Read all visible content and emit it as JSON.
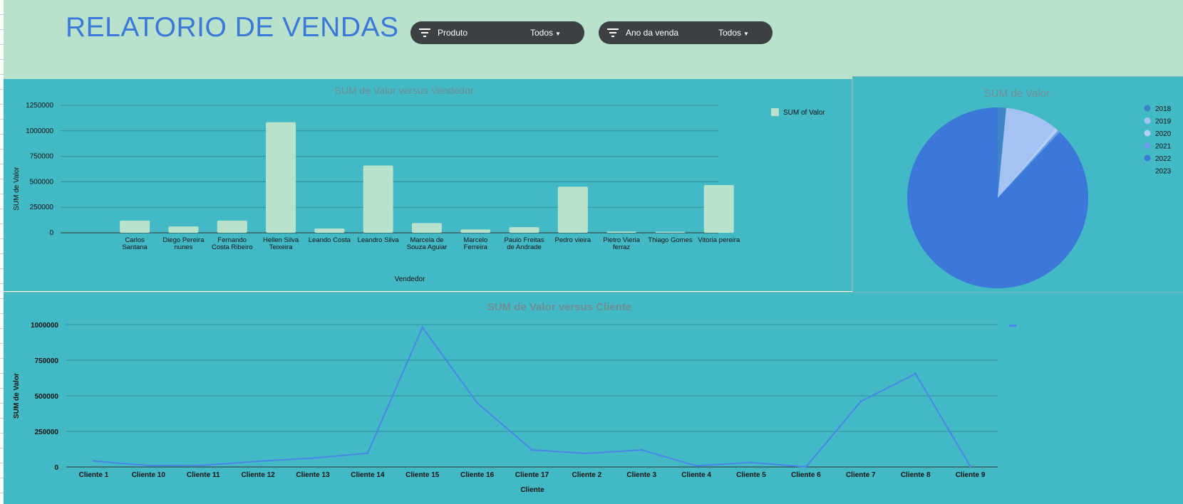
{
  "header": {
    "title": "RELATORIO DE VENDAS",
    "filters": [
      {
        "label": "Produto",
        "value": "Todos"
      },
      {
        "label": "Ano da venda",
        "value": "Todos"
      }
    ]
  },
  "colors": {
    "header_bg": "#b8e2cc",
    "panel_bg": "#44b9c6",
    "bar": "#b8e2cc",
    "line": "#4a86e8",
    "title": "#3c78d8"
  },
  "chart_data": [
    {
      "type": "bar",
      "title": "SUM de Valor versus Vendedor",
      "xlabel": "Vendedor",
      "ylabel": "SUM de Valor",
      "legend": [
        "SUM of Valor"
      ],
      "legend_position": "top-right",
      "ylim": [
        0,
        1250000
      ],
      "yticks": [
        "1250000",
        "1000000",
        "750000",
        "500000",
        "250000",
        "0"
      ],
      "categories": [
        "Carlos Santana",
        "Diego Pereira nunes",
        "Fernando Costa Ribeiro",
        "Hellen Silva Teixeira",
        "Leando Costa",
        "Leandro Silva",
        "Marcela de Souza Aguiar",
        "Marcelo Ferreira",
        "Paulo Freitas de Andrade",
        "Pedro vieira",
        "Pietro Vieria ferraz",
        "Thiago Gomes",
        "Vitoria pereira"
      ],
      "category_lines": [
        [
          "Carlos",
          "Santana"
        ],
        [
          "Diego Pereira",
          "nunes"
        ],
        [
          "Fernando",
          "Costa Ribeiro"
        ],
        [
          "Hellen Silva",
          "Teixeira"
        ],
        [
          "Leando Costa"
        ],
        [
          "Leandro Silva"
        ],
        [
          "Marcela de",
          "Souza Aguiar"
        ],
        [
          "Marcelo",
          "Ferreira"
        ],
        [
          "Paulo Freitas",
          "de Andrade"
        ],
        [
          "Pedro vieira"
        ],
        [
          "Pietro Vieria",
          "ferraz"
        ],
        [
          "Thiago Gomes"
        ],
        [
          "Vitoria pereira"
        ]
      ],
      "values": [
        120000,
        62000,
        120000,
        1085000,
        42000,
        660000,
        95000,
        32000,
        55000,
        452000,
        12000,
        10000,
        468000
      ]
    },
    {
      "type": "pie",
      "title": "SUM de Valor",
      "legend_position": "right",
      "labels": [
        "2018",
        "2019",
        "2020",
        "2021",
        "2022",
        "2023"
      ],
      "values": [
        1.5,
        9.5,
        0.6,
        0.4,
        88.0,
        0
      ],
      "colors": [
        "#3d85c6",
        "#a4c2f4",
        "#b6cff3",
        "#6d9eeb",
        "#3c78d8",
        "#44b9c6"
      ]
    },
    {
      "type": "line",
      "title": "SUM de Valor versus Cliente",
      "xlabel": "Cliente",
      "ylabel": "SUM de Valor",
      "ylim": [
        0,
        1000000
      ],
      "yticks": [
        "1000000",
        "750000",
        "500000",
        "250000",
        "0"
      ],
      "categories": [
        "Cliente 1",
        "Cliente 10",
        "Cliente 11",
        "Cliente 12",
        "Cliente 13",
        "Cliente 14",
        "Cliente 15",
        "Cliente 16",
        "Cliente 17",
        "Cliente 2",
        "Cliente 3",
        "Cliente 4",
        "Cliente 5",
        "Cliente 6",
        "Cliente 7",
        "Cliente 8",
        "Cliente 9"
      ],
      "values": [
        42000,
        10000,
        12000,
        40000,
        62000,
        97000,
        980000,
        450000,
        120000,
        95000,
        120000,
        8000,
        32000,
        0,
        460000,
        655000,
        5000
      ]
    }
  ]
}
